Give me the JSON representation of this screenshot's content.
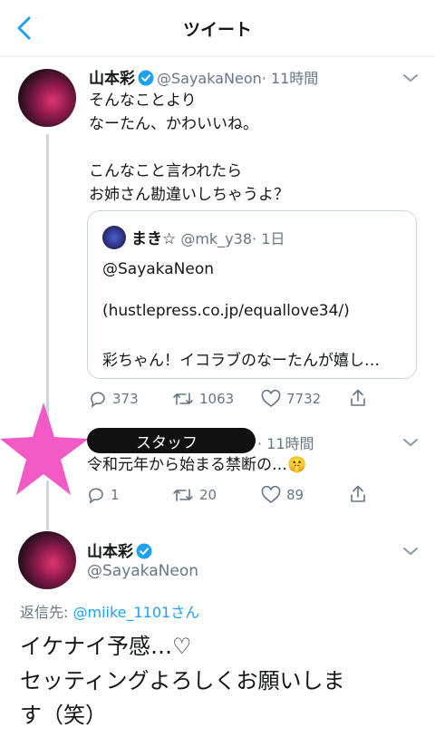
{
  "header": {
    "title": "ツイート"
  },
  "tweet1": {
    "name": "山本彩",
    "handle": "@SayakaNeon",
    "time": "· 11時間",
    "text": "そんなことより\nなーたん、かわいいね。\n\nこんなこと言われたら\nお姉さん勘違いしちゃうよ？",
    "quote": {
      "name": "まき☆",
      "handle": "@mk_y38",
      "time": "· 1日",
      "line1": "@SayakaNeon",
      "line2": "(hustlepress.co.jp/equallove34/)",
      "line3": "彩ちゃん！イコラブのなーたんが嬉し…"
    },
    "replies": "373",
    "retweets": "1063",
    "likes": "7732"
  },
  "tweet2": {
    "name": "スタッフ",
    "time": "· 11時間",
    "text": "令和元年から始まる禁断の…🤫",
    "replies": "1",
    "retweets": "20",
    "likes": "89"
  },
  "tweet3": {
    "name": "山本彩",
    "handle": "@SayakaNeon",
    "reply_prefix": "返信先: ",
    "reply_to": "@miike_1101さん",
    "text": "イケナイ予感…♡\nセッティングよろしくお願いしま\nす（笑）"
  },
  "colors": {
    "accent": "#1da1f2",
    "muted": "#657786",
    "star": "#f25bc6"
  }
}
